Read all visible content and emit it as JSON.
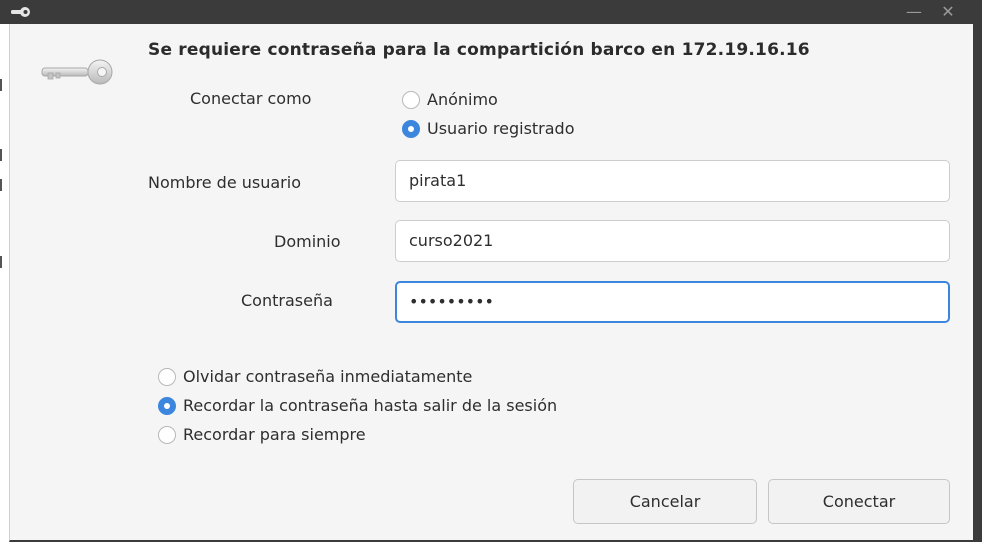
{
  "window": {
    "minimize_glyph": "—",
    "close_glyph": "✕"
  },
  "dialog": {
    "heading": "Se requiere contraseña para la compartición barco en 172.19.16.16",
    "connect_as": {
      "label": "Conectar como",
      "options": [
        {
          "label": "Anónimo",
          "checked": false
        },
        {
          "label": "Usuario registrado",
          "checked": true
        }
      ]
    },
    "username": {
      "label": "Nombre de usuario",
      "value": "pirata1"
    },
    "domain": {
      "label": "Dominio",
      "value": "curso2021"
    },
    "password": {
      "label": "Contraseña",
      "value": "•••••••••"
    },
    "remember": {
      "options": [
        {
          "label": "Olvidar contraseña inmediatamente",
          "checked": false
        },
        {
          "label": "Recordar la contraseña hasta salir de la sesión",
          "checked": true
        },
        {
          "label": "Recordar para siempre",
          "checked": false
        }
      ]
    },
    "buttons": {
      "cancel": "Cancelar",
      "connect": "Conectar"
    }
  },
  "colors": {
    "titlebar": "#3b3b3b",
    "accent": "#3d86dd",
    "dialog_bg": "#f5f5f5"
  },
  "icons": {
    "title": "key-icon",
    "dialog": "key-icon",
    "minimize": "minimize-icon",
    "close": "close-icon"
  }
}
